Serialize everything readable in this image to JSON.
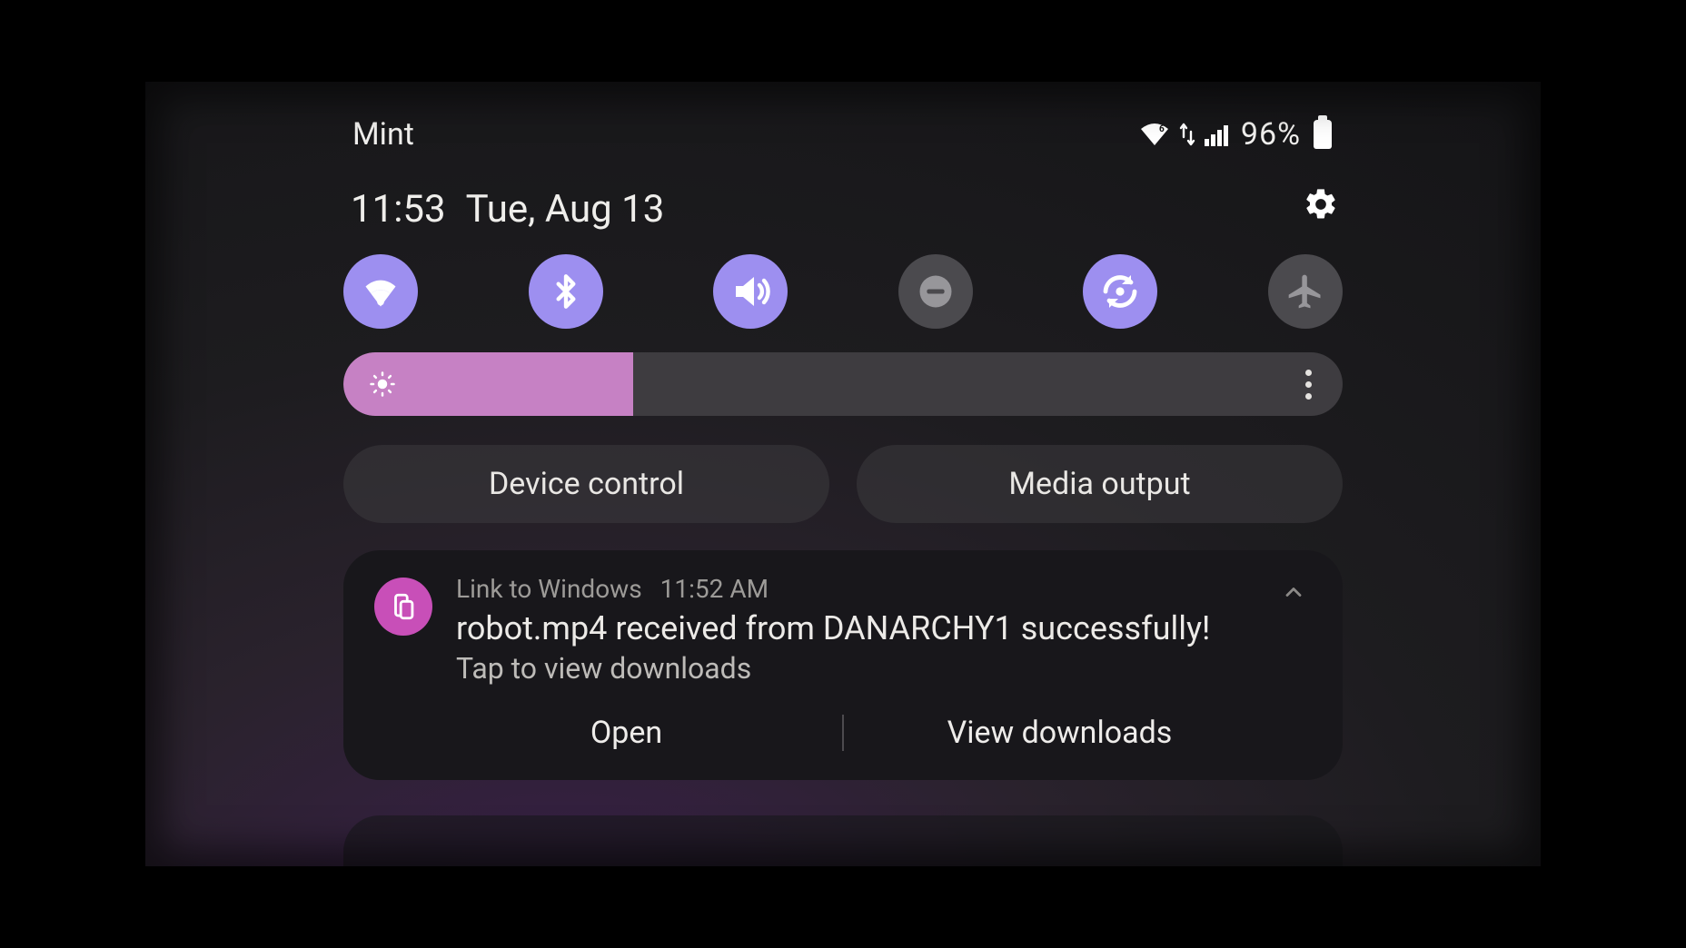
{
  "status": {
    "carrier": "Mint",
    "battery_pct": "96%"
  },
  "header": {
    "time": "11:53",
    "date": "Tue, Aug 13"
  },
  "toggles": [
    {
      "name": "wifi",
      "on": true
    },
    {
      "name": "bluetooth",
      "on": true
    },
    {
      "name": "sound",
      "on": true
    },
    {
      "name": "dnd",
      "on": false
    },
    {
      "name": "auto-rotate",
      "on": true
    },
    {
      "name": "airplane",
      "on": false
    }
  ],
  "brightness": {
    "pct": 29
  },
  "pills": {
    "device_control": "Device control",
    "media_output": "Media output"
  },
  "notification": {
    "app": "Link to Windows",
    "timestamp": "11:52 AM",
    "title": "robot.mp4 received from DANARCHY1 successfully!",
    "subtitle": "Tap to view downloads",
    "actions": {
      "open": "Open",
      "view_downloads": "View downloads"
    }
  }
}
